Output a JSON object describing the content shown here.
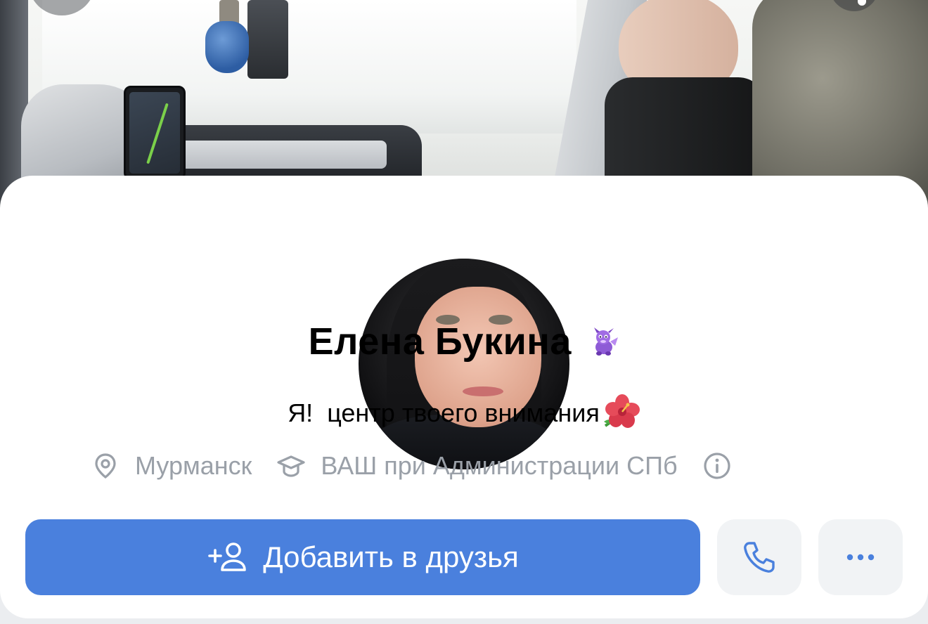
{
  "profile": {
    "name": "Елена Букина",
    "name_badge_icon": "purple-dragon-emoji",
    "status_text": "Я!  центр твоего внимания",
    "status_emoji_icon": "hibiscus-emoji",
    "city": "Мурманск",
    "education": "ВАШ при Администрации СПб"
  },
  "actions": {
    "add_friend_label": "Добавить в друзья",
    "add_friend_icon": "add-user-icon",
    "call_icon": "phone-icon",
    "more_icon": "more-dots-icon"
  },
  "colors": {
    "primary_button": "#4a80dd",
    "secondary_text": "#9aa0a8",
    "icon_accent": "#4a80dd"
  }
}
